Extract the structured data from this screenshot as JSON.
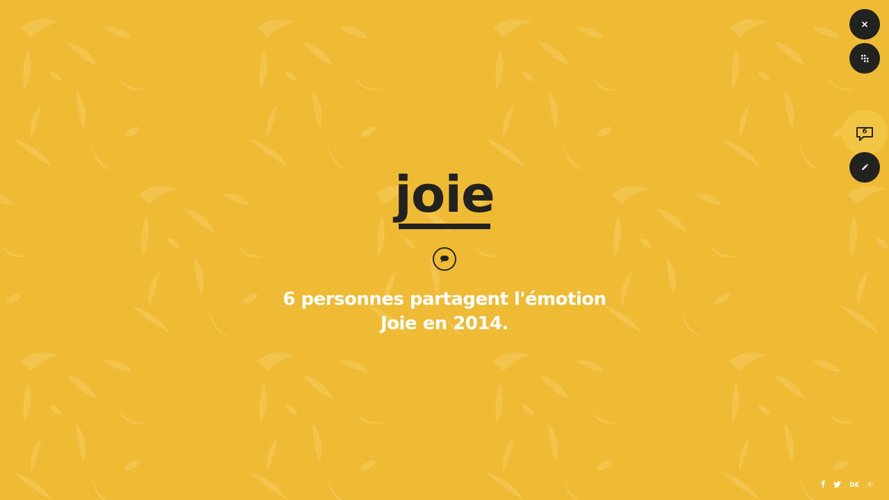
{
  "colors": {
    "background": "#f0bb34",
    "dark": "#222220",
    "statement_text": "#ffffff"
  },
  "emotion": {
    "word": "joie"
  },
  "statement": {
    "line1": "6 personnes partagent l'émotion",
    "line2": "Joie en 2014."
  },
  "side_controls": {
    "close_icon": "close-icon",
    "menu_icon": "grid-dots-icon",
    "comment_count": "6",
    "comment_icon": "speech-bubble-icon",
    "edit_icon": "pencil-icon"
  },
  "footer": {
    "language": "DE",
    "icons": [
      "facebook-icon",
      "twitter-icon",
      "sound-icon"
    ]
  }
}
